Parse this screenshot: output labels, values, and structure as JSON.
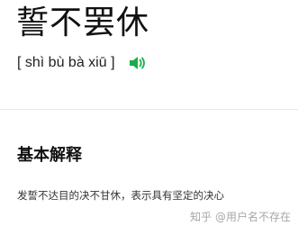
{
  "word": {
    "title": "誓不罢休",
    "pinyin": "[ shì bù bà xiū ]"
  },
  "icons": {
    "pronounce": "speaker-icon",
    "accent_color": "#1aad4b"
  },
  "basic": {
    "heading": "基本解释",
    "definition": "发誓不达目的决不甘休，表示具有坚定的决心"
  },
  "watermark": {
    "text": "知乎 @用户名不存在"
  }
}
